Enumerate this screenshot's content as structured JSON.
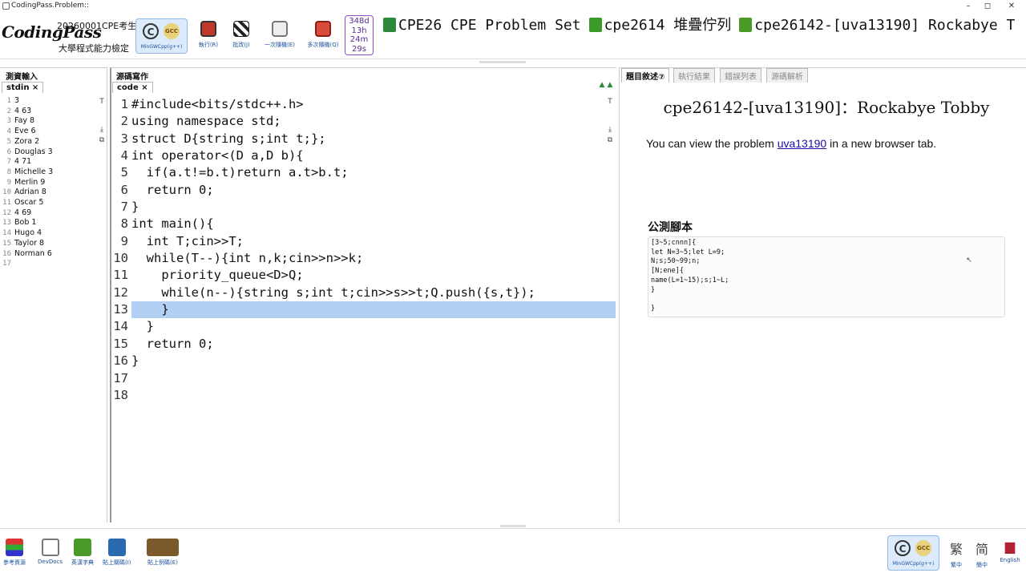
{
  "window": {
    "title": "CodingPass.Problem::",
    "min": "–",
    "max": "◻",
    "close": "✕"
  },
  "header": {
    "logo": "CodingPass",
    "exam_id": "20260001CPE考生",
    "exam_name": "大學程式能力檢定",
    "compiler_label": "MinGWCpp(g++)",
    "buttons": [
      {
        "label": "執行(R)",
        "icon": "cube-run-icon",
        "color": "#c0392b"
      },
      {
        "label": "批改(J)",
        "icon": "checkered-flag-icon",
        "color": "#222222"
      },
      {
        "label": "一次隨機(E)",
        "icon": "dice-icon",
        "color": "#7a7a7a"
      },
      {
        "label": "多次隨機(Q)",
        "icon": "red-dice-icon",
        "color": "#c0392b"
      }
    ],
    "timer": [
      "348d",
      "13h",
      "24m",
      "29s"
    ],
    "breadcrumbs": [
      "CPE26 CPE Problem Set",
      "cpe2614 堆疊佇列",
      "cpe26142-[uva13190] Rockabye T"
    ]
  },
  "stdin": {
    "panel_tab": "測資輸入",
    "tab": "stdin ×",
    "lines": [
      "3",
      "4 63",
      "Fay 8",
      "Eve 6",
      "Zora 2",
      "Douglas 3",
      "4 71",
      "Michelle 3",
      "Merlin 9",
      "Adrian 8",
      "Oscar 5",
      "4 69",
      "Bob 1",
      "Hugo 4",
      "Taylor 8",
      "Norman 6",
      ""
    ]
  },
  "code": {
    "panel_tab": "源碼寫作",
    "tab": "code ×",
    "lines": [
      "#include<bits/stdc++.h>",
      "using namespace std;",
      "struct D{string s;int t;};",
      "int operator<(D a,D b){",
      "  if(a.t!=b.t)return a.t>b.t;",
      "  return 0;",
      "}",
      "int main(){",
      "  int T;cin>>T;",
      "  while(T--){int n,k;cin>>n>>k;",
      "    priority_queue<D>Q;",
      "    while(n--){string s;int t;cin>>s>>t;Q.push({s,t});",
      "    }",
      "  }",
      "  return 0;",
      "}",
      "",
      ""
    ]
  },
  "desc": {
    "tabs": [
      "題目敘述⑦",
      "執行結果",
      "錯誤列表",
      "源碼解析"
    ],
    "title": "cpe26142-[uva13190]：Rockabye Tobby",
    "view_prefix": "You can view the problem ",
    "view_link": "uva13190",
    "view_suffix": " in a new browser tab.",
    "script_title": "公測腳本",
    "script_text": "[3~5;cnnn]{\nlet N=3~5;let L=9;\nN;s;50~99;n;\n[N;ene]{\nname(L=1~15);s;1~L;\n}\n\n}"
  },
  "footer": {
    "buttons": [
      {
        "label": "參考資源",
        "icon": "books-icon",
        "color": "#3a8f3a"
      },
      {
        "label": "DevDocs",
        "icon": "magnifier-icon",
        "color": "#777777"
      },
      {
        "label": "英漢字典",
        "icon": "dictionary-icon",
        "color": "#4a9a2a"
      },
      {
        "label": "貼上關碼(I)",
        "icon": "paste-code-icon",
        "color": "#2a6ab0"
      },
      {
        "label": "貼上例碼(E)",
        "icon": "open-book-icon",
        "color": "#7a5a2a"
      }
    ],
    "compiler_label": "MinGWCpp(g++)",
    "langs": [
      {
        "glyph": "繁",
        "label": "繁中"
      },
      {
        "glyph": "简",
        "label": "簡中"
      },
      {
        "glyph": "▆",
        "label": "English"
      }
    ]
  }
}
